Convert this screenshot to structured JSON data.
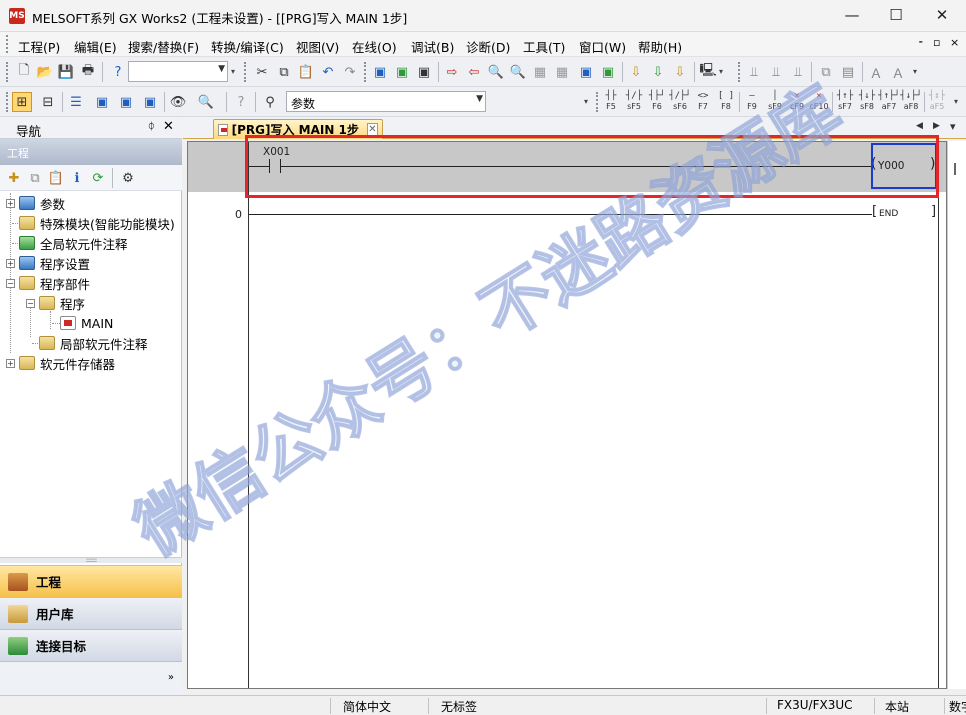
{
  "window": {
    "app_icon": "MELSOFT",
    "title": "MELSOFT系列 GX Works2 (工程未设置) - [[PRG]写入 MAIN 1步]",
    "minimize": "—",
    "maximize": "☐",
    "close": "✕"
  },
  "menubar": {
    "items": [
      "工程(P)",
      "编辑(E)",
      "搜索/替换(F)",
      "转换/编译(C)",
      "视图(V)",
      "在线(O)",
      "调试(B)",
      "诊断(D)",
      "工具(T)",
      "窗口(W)",
      "帮助(H)"
    ],
    "mdi_controls": [
      "⁃",
      "▫",
      "×"
    ]
  },
  "toolbar1": {
    "project_combo_value": ""
  },
  "toolbar2": {
    "param_combo_value": "参数",
    "function_keys": [
      {
        "sym": "┤├",
        "label": "F5",
        "style": "normal"
      },
      {
        "sym": "┤/├",
        "label": "sF5",
        "style": "normal"
      },
      {
        "sym": "┤├┘",
        "label": "F6",
        "style": "normal"
      },
      {
        "sym": "┤/├┘",
        "label": "sF6",
        "style": "normal"
      },
      {
        "sym": "<>",
        "label": "F7",
        "style": "normal"
      },
      {
        "sym": "[ ]",
        "label": "F8",
        "style": "normal"
      },
      {
        "sym": "—",
        "label": "F9",
        "style": "normal"
      },
      {
        "sym": "│",
        "label": "sF9",
        "style": "normal"
      },
      {
        "sym": "✕",
        "label": "cF9",
        "style": "red"
      },
      {
        "sym": "✕",
        "label": "cF10",
        "style": "red"
      },
      {
        "sym": "┤↑├",
        "label": "sF7",
        "style": "normal"
      },
      {
        "sym": "┤↓├",
        "label": "sF8",
        "style": "normal"
      },
      {
        "sym": "┤↑├┘",
        "label": "aF7",
        "style": "normal"
      },
      {
        "sym": "┤↓├┘",
        "label": "aF8",
        "style": "normal"
      },
      {
        "sym": "┤↕├",
        "label": "aF5",
        "style": "dim"
      }
    ]
  },
  "navigation": {
    "title": "导航",
    "pin": "ᛰ",
    "close": "✕",
    "section": "工程",
    "tree": [
      {
        "label": "参数",
        "expander": "+"
      },
      {
        "label": "特殊模块(智能功能模块)",
        "expander": ""
      },
      {
        "label": "全局软元件注释",
        "expander": ""
      },
      {
        "label": "程序设置",
        "expander": "+"
      },
      {
        "label": "程序部件",
        "expander": "−"
      },
      {
        "label": "程序",
        "expander": "−"
      },
      {
        "label": "MAIN",
        "expander": ""
      },
      {
        "label": "局部软元件注释",
        "expander": ""
      },
      {
        "label": "软元件存储器",
        "expander": "+"
      }
    ],
    "splitter": "::::::::::",
    "buttons": [
      {
        "label": "工程",
        "active": true
      },
      {
        "label": "用户库",
        "active": false
      },
      {
        "label": "连接目标",
        "active": false
      }
    ],
    "more": "»"
  },
  "document": {
    "tab_label": "[PRG]写入 MAIN 1步",
    "tab_close": "✕",
    "nav_left": "◀",
    "nav_right": "▶",
    "nav_menu": "▾"
  },
  "ladder": {
    "rungs": [
      {
        "step": "",
        "contact": "X001",
        "coil": "Y000"
      },
      {
        "step": "0",
        "contact": "",
        "coil": "END"
      }
    ]
  },
  "watermark": {
    "text": "微信公众号：不迷路资源库"
  },
  "statusbar": {
    "language": "简体中文",
    "label": "无标签",
    "plc_model": "FX3U/FX3UC",
    "station": "本站",
    "extra": "数字"
  },
  "colors": {
    "selection_highlight": "#e4262a",
    "coil_cursor": "#1a3cc8",
    "active_nav": "#f6c14b",
    "rung_selected": "#c8c8c8"
  }
}
